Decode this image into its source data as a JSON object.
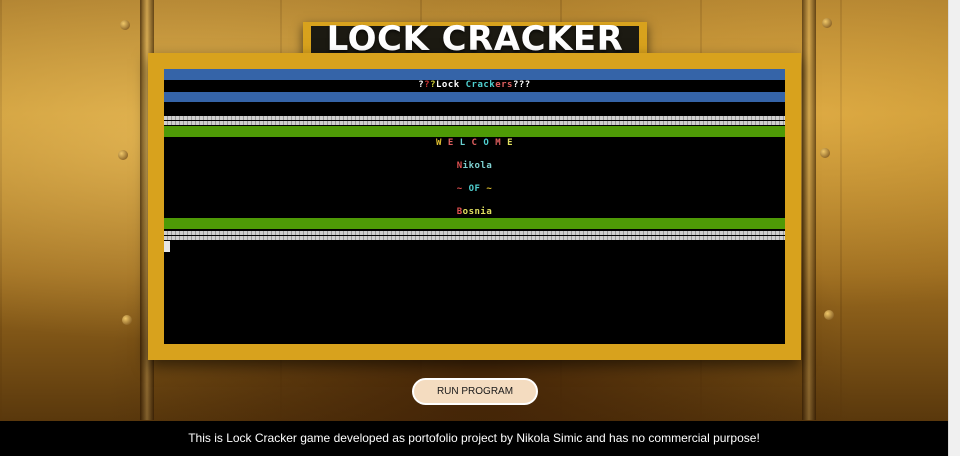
{
  "header": {
    "title": "LOCK CRACKER"
  },
  "terminal": {
    "banner_title": [
      {
        "t": "?",
        "c": "#ffffff"
      },
      {
        "t": "?",
        "c": "#cc3333"
      },
      {
        "t": "?",
        "c": "#cccc33"
      },
      {
        "t": "Lock ",
        "c": "#ffffff"
      },
      {
        "t": "Crack",
        "c": "#4fd0d0"
      },
      {
        "t": "ers",
        "c": "#e06060"
      },
      {
        "t": "???",
        "c": "#ffffff"
      }
    ],
    "welcome": [
      {
        "t": "W ",
        "c": "#e0c030"
      },
      {
        "t": "E ",
        "c": "#e06060"
      },
      {
        "t": "L ",
        "c": "#6ad0d0"
      },
      {
        "t": "C ",
        "c": "#e06060"
      },
      {
        "t": "O ",
        "c": "#4fd0d0"
      },
      {
        "t": "M ",
        "c": "#e06060"
      },
      {
        "t": "E",
        "c": "#e0e060"
      }
    ],
    "author": [
      {
        "t": "N",
        "c": "#e05050"
      },
      {
        "t": "ikola",
        "c": "#7fd0d0"
      }
    ],
    "of_line": [
      {
        "t": "~ ",
        "c": "#e05050"
      },
      {
        "t": "OF",
        "c": "#4fd0d0"
      },
      {
        "t": " ~",
        "c": "#e0c030"
      }
    ],
    "country": [
      {
        "t": "B",
        "c": "#e05050"
      },
      {
        "t": "osnia",
        "c": "#e0e060"
      }
    ]
  },
  "controls": {
    "run_label": "RUN PROGRAM"
  },
  "footer": {
    "text": "This is Lock Cracker game developed as portofolio project by Nikola Simic and has no commercial purpose!"
  },
  "colors": {
    "frame": "#d8a21d",
    "banner_blue": "#3564a8",
    "banner_green": "#4e9a06",
    "button_bg": "#f4dcc0"
  }
}
